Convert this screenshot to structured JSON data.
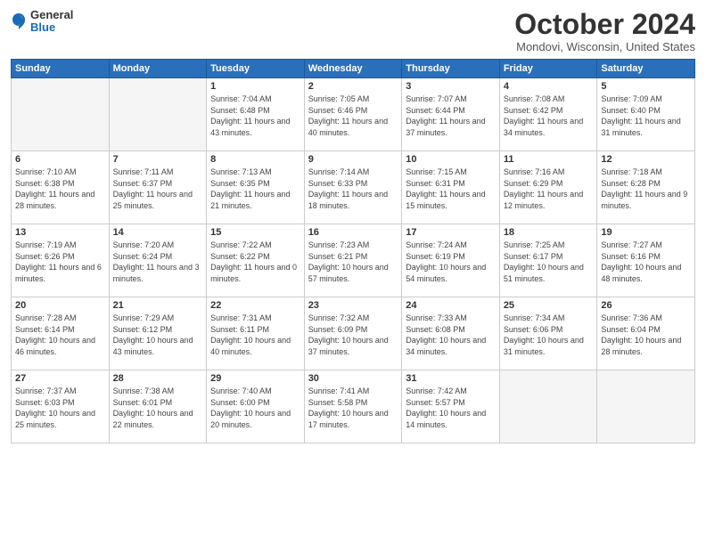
{
  "header": {
    "logo_general": "General",
    "logo_blue": "Blue",
    "title": "October 2024",
    "location": "Mondovi, Wisconsin, United States"
  },
  "days_of_week": [
    "Sunday",
    "Monday",
    "Tuesday",
    "Wednesday",
    "Thursday",
    "Friday",
    "Saturday"
  ],
  "weeks": [
    [
      {
        "day": "",
        "info": ""
      },
      {
        "day": "",
        "info": ""
      },
      {
        "day": "1",
        "info": "Sunrise: 7:04 AM\nSunset: 6:48 PM\nDaylight: 11 hours and 43 minutes."
      },
      {
        "day": "2",
        "info": "Sunrise: 7:05 AM\nSunset: 6:46 PM\nDaylight: 11 hours and 40 minutes."
      },
      {
        "day": "3",
        "info": "Sunrise: 7:07 AM\nSunset: 6:44 PM\nDaylight: 11 hours and 37 minutes."
      },
      {
        "day": "4",
        "info": "Sunrise: 7:08 AM\nSunset: 6:42 PM\nDaylight: 11 hours and 34 minutes."
      },
      {
        "day": "5",
        "info": "Sunrise: 7:09 AM\nSunset: 6:40 PM\nDaylight: 11 hours and 31 minutes."
      }
    ],
    [
      {
        "day": "6",
        "info": "Sunrise: 7:10 AM\nSunset: 6:38 PM\nDaylight: 11 hours and 28 minutes."
      },
      {
        "day": "7",
        "info": "Sunrise: 7:11 AM\nSunset: 6:37 PM\nDaylight: 11 hours and 25 minutes."
      },
      {
        "day": "8",
        "info": "Sunrise: 7:13 AM\nSunset: 6:35 PM\nDaylight: 11 hours and 21 minutes."
      },
      {
        "day": "9",
        "info": "Sunrise: 7:14 AM\nSunset: 6:33 PM\nDaylight: 11 hours and 18 minutes."
      },
      {
        "day": "10",
        "info": "Sunrise: 7:15 AM\nSunset: 6:31 PM\nDaylight: 11 hours and 15 minutes."
      },
      {
        "day": "11",
        "info": "Sunrise: 7:16 AM\nSunset: 6:29 PM\nDaylight: 11 hours and 12 minutes."
      },
      {
        "day": "12",
        "info": "Sunrise: 7:18 AM\nSunset: 6:28 PM\nDaylight: 11 hours and 9 minutes."
      }
    ],
    [
      {
        "day": "13",
        "info": "Sunrise: 7:19 AM\nSunset: 6:26 PM\nDaylight: 11 hours and 6 minutes."
      },
      {
        "day": "14",
        "info": "Sunrise: 7:20 AM\nSunset: 6:24 PM\nDaylight: 11 hours and 3 minutes."
      },
      {
        "day": "15",
        "info": "Sunrise: 7:22 AM\nSunset: 6:22 PM\nDaylight: 11 hours and 0 minutes."
      },
      {
        "day": "16",
        "info": "Sunrise: 7:23 AM\nSunset: 6:21 PM\nDaylight: 10 hours and 57 minutes."
      },
      {
        "day": "17",
        "info": "Sunrise: 7:24 AM\nSunset: 6:19 PM\nDaylight: 10 hours and 54 minutes."
      },
      {
        "day": "18",
        "info": "Sunrise: 7:25 AM\nSunset: 6:17 PM\nDaylight: 10 hours and 51 minutes."
      },
      {
        "day": "19",
        "info": "Sunrise: 7:27 AM\nSunset: 6:16 PM\nDaylight: 10 hours and 48 minutes."
      }
    ],
    [
      {
        "day": "20",
        "info": "Sunrise: 7:28 AM\nSunset: 6:14 PM\nDaylight: 10 hours and 46 minutes."
      },
      {
        "day": "21",
        "info": "Sunrise: 7:29 AM\nSunset: 6:12 PM\nDaylight: 10 hours and 43 minutes."
      },
      {
        "day": "22",
        "info": "Sunrise: 7:31 AM\nSunset: 6:11 PM\nDaylight: 10 hours and 40 minutes."
      },
      {
        "day": "23",
        "info": "Sunrise: 7:32 AM\nSunset: 6:09 PM\nDaylight: 10 hours and 37 minutes."
      },
      {
        "day": "24",
        "info": "Sunrise: 7:33 AM\nSunset: 6:08 PM\nDaylight: 10 hours and 34 minutes."
      },
      {
        "day": "25",
        "info": "Sunrise: 7:34 AM\nSunset: 6:06 PM\nDaylight: 10 hours and 31 minutes."
      },
      {
        "day": "26",
        "info": "Sunrise: 7:36 AM\nSunset: 6:04 PM\nDaylight: 10 hours and 28 minutes."
      }
    ],
    [
      {
        "day": "27",
        "info": "Sunrise: 7:37 AM\nSunset: 6:03 PM\nDaylight: 10 hours and 25 minutes."
      },
      {
        "day": "28",
        "info": "Sunrise: 7:38 AM\nSunset: 6:01 PM\nDaylight: 10 hours and 22 minutes."
      },
      {
        "day": "29",
        "info": "Sunrise: 7:40 AM\nSunset: 6:00 PM\nDaylight: 10 hours and 20 minutes."
      },
      {
        "day": "30",
        "info": "Sunrise: 7:41 AM\nSunset: 5:58 PM\nDaylight: 10 hours and 17 minutes."
      },
      {
        "day": "31",
        "info": "Sunrise: 7:42 AM\nSunset: 5:57 PM\nDaylight: 10 hours and 14 minutes."
      },
      {
        "day": "",
        "info": ""
      },
      {
        "day": "",
        "info": ""
      }
    ]
  ]
}
